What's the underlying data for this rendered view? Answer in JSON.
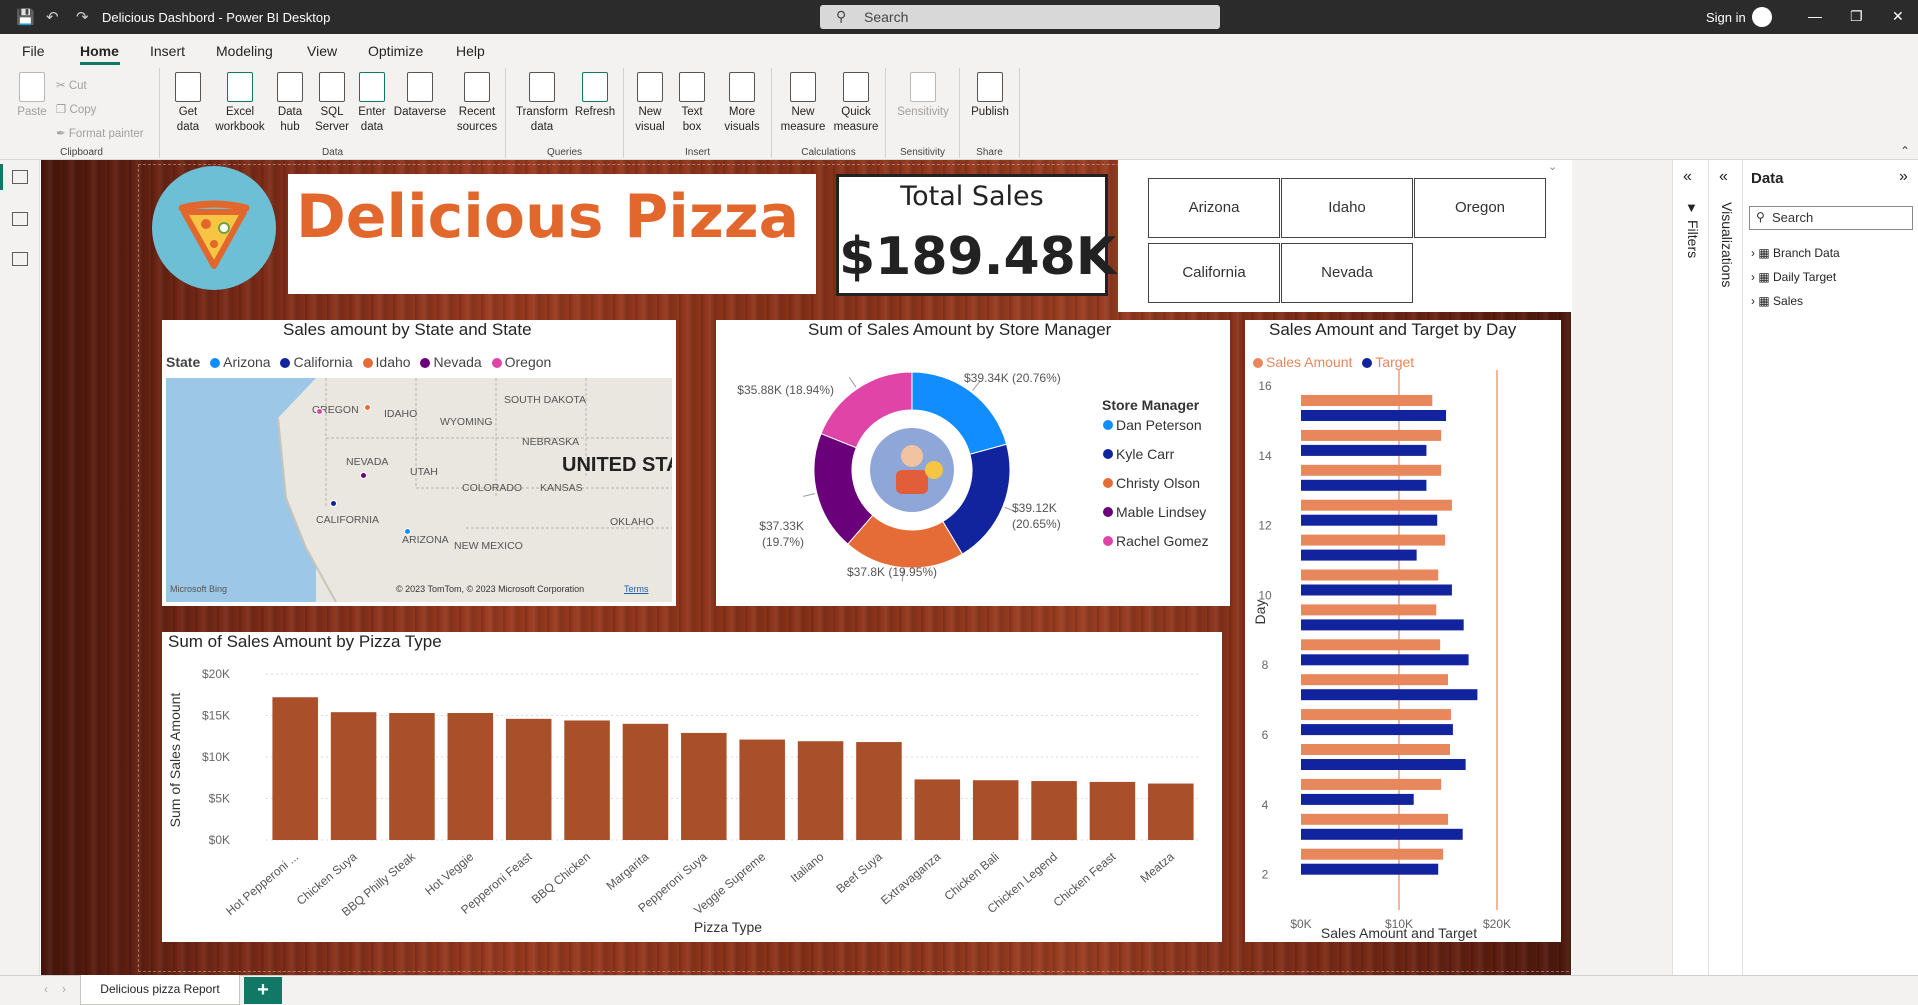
{
  "app": {
    "title": "Delicious Dashbord - Power BI Desktop",
    "search_placeholder": "Search",
    "sign_in": "Sign in"
  },
  "menu": [
    "File",
    "Home",
    "Insert",
    "Modeling",
    "View",
    "Optimize",
    "Help"
  ],
  "active_menu": "Home",
  "ribbon": {
    "clipboard": {
      "paste": "Paste",
      "cut": "Cut",
      "copy": "Copy",
      "format_painter": "Format painter",
      "label": "Clipboard"
    },
    "data": {
      "get_data": "Get data",
      "excel": "Excel workbook",
      "data_hub": "Data hub",
      "sql": "SQL Server",
      "enter_data": "Enter data",
      "dataverse": "Dataverse",
      "recent": "Recent sources",
      "label": "Data"
    },
    "queries": {
      "transform": "Transform data",
      "refresh": "Refresh",
      "label": "Queries"
    },
    "insert": {
      "new_visual": "New visual",
      "text_box": "Text box",
      "more_visuals": "More visuals",
      "label": "Insert"
    },
    "calculations": {
      "new_measure": "New measure",
      "quick_measure": "Quick measure",
      "label": "Calculations"
    },
    "sensitivity": {
      "sensitivity": "Sensitivity",
      "label": "Sensitivity"
    },
    "share": {
      "publish": "Publish",
      "label": "Share"
    }
  },
  "report": {
    "brand": "Delicious Pizza",
    "kpi_title": "Total Sales",
    "kpi_value": "$189.48K",
    "slicer_states": [
      "Arizona",
      "Idaho",
      "Oregon",
      "California",
      "Nevada"
    ]
  },
  "map_visual": {
    "title": "Sales amount by State and State",
    "legend_title": "State",
    "legend": [
      {
        "name": "Arizona",
        "color": "#118dff"
      },
      {
        "name": "California",
        "color": "#12239e"
      },
      {
        "name": "Idaho",
        "color": "#e66c37"
      },
      {
        "name": "Nevada",
        "color": "#6b007b"
      },
      {
        "name": "Oregon",
        "color": "#e044a7"
      }
    ],
    "labels": [
      "SOUTH DAKOTA",
      "OREGON",
      "IDAHO",
      "WYOMING",
      "NEBRASKA",
      "NEVADA",
      "UTAH",
      "UNITED STA",
      "COLORADO",
      "KANSAS",
      "CALIFORNIA",
      "OKLAHO",
      "ARIZONA",
      "NEW MEXICO"
    ],
    "attribution": "© 2023 TomTom, © 2023 Microsoft Corporation",
    "terms": "Terms",
    "bing": "Microsoft Bing"
  },
  "chart_data": [
    {
      "type": "pie",
      "title": "Sum of Sales Amount by Store Manager",
      "legend_title": "Store Manager",
      "categories": [
        "Dan  Peterson",
        "Kyle  Carr",
        "Christy  Olson",
        "Mable  Lindsey",
        "Rachel  Gomez"
      ],
      "values": [
        39.34,
        39.12,
        37.8,
        37.33,
        35.88
      ],
      "labels": [
        "$39.34K (20.76%)",
        "$39.12K (20.65%)",
        "$37.8K (19.95%)",
        "$37.33K (19.7%)",
        "$35.88K (18.94%)"
      ],
      "colors": [
        "#118dff",
        "#12239e",
        "#e66c37",
        "#6b007b",
        "#e044a7"
      ]
    },
    {
      "type": "bar",
      "title": "Sum of Sales Amount by Pizza Type",
      "xlabel": "Pizza Type",
      "ylabel": "Sum of Sales Amount",
      "categories": [
        "Hot Pepperoni ...",
        "Chicken Suya",
        "BBQ Philly Steak",
        "Hot Veggie",
        "Pepperoni Feast",
        "BBQ Chicken",
        "Margarita",
        "Pepperoni Suya",
        "Veggie Supreme",
        "Italiano",
        "Beef Suya",
        "Extravaganza",
        "Chicken Bali",
        "Chicken Legend",
        "Chicken Feast",
        "Meatza"
      ],
      "values": [
        17200,
        15400,
        15300,
        15300,
        14600,
        14400,
        14000,
        12900,
        12100,
        11900,
        11800,
        7300,
        7200,
        7100,
        7000,
        6800
      ],
      "ylim": [
        0,
        20000
      ],
      "yticks": [
        "$0K",
        "$5K",
        "$10K",
        "$15K",
        "$20K"
      ],
      "color": "#a94f2a"
    },
    {
      "type": "bar",
      "orientation": "horizontal",
      "title": "Sales Amount and Target by Day",
      "xlabel": "Sales Amount and Target",
      "ylabel": "Day",
      "days": [
        16,
        15,
        14,
        13,
        12,
        11,
        10,
        9,
        8,
        7,
        6,
        5,
        4,
        3
      ],
      "series": [
        {
          "name": "Sales Amount",
          "color": "#e8875c",
          "values": [
            13400,
            14300,
            14300,
            15400,
            14700,
            14000,
            13800,
            14200,
            15000,
            15300,
            15200,
            14300,
            15000,
            14500
          ]
        },
        {
          "name": "Target",
          "color": "#12239e",
          "values": [
            14800,
            12800,
            12800,
            13900,
            11800,
            15400,
            16600,
            17100,
            18000,
            15500,
            16800,
            11500,
            16500,
            14000
          ]
        }
      ],
      "xticks": [
        "$0K",
        "$10K",
        "$20K"
      ],
      "yticks": [
        "16",
        "14",
        "12",
        "10",
        "8",
        "6",
        "4",
        "2"
      ],
      "xlim": [
        0,
        20000
      ]
    }
  ],
  "panes": {
    "filters": "Filters",
    "visualizations": "Visualizations",
    "data_title": "Data",
    "data_search": "Search",
    "tables": [
      "Branch Data",
      "Daily Target",
      "Sales"
    ]
  },
  "page_tab": "Delicious pizza Report",
  "add_page": "+"
}
